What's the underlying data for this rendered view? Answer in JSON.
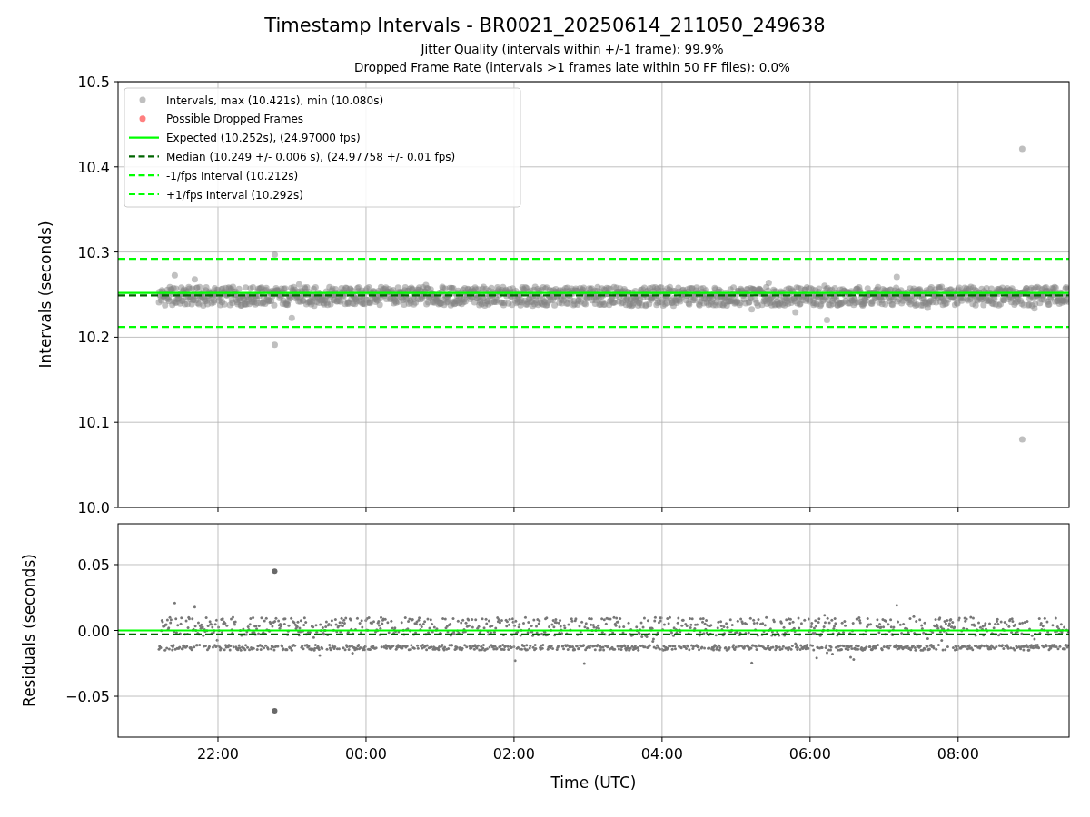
{
  "figure": {
    "title": "Timestamp Intervals - BR0021_20250614_211050_249638",
    "subtitles": [
      "Jitter Quality (intervals within +/-1 frame): 99.9%",
      "Dropped Frame Rate (intervals >1 frames late within 50 FF files): 0.0%"
    ]
  },
  "intervals_plot": {
    "chart_data": {
      "type": "scatter",
      "ylabel": "Intervals (seconds)",
      "grid": true,
      "legend": "upper left",
      "xlim": [
        "2025-06-14T20:39",
        "2025-06-15T09:30"
      ],
      "ylim": [
        10.0,
        10.5
      ],
      "yticks": [
        {
          "value": 10.0,
          "label": "10.0"
        },
        {
          "value": 10.1,
          "label": "10.1"
        },
        {
          "value": 10.2,
          "label": "10.2"
        },
        {
          "value": 10.3,
          "label": "10.3"
        },
        {
          "value": 10.4,
          "label": "10.4"
        },
        {
          "value": 10.5,
          "label": "10.5"
        }
      ],
      "series": [
        {
          "name": "Intervals, max (10.421s), min (10.080s)",
          "color": "#808080",
          "x": [
            "2025-06-14T22:46",
            "2025-06-14T22:46",
            "2025-06-15T08:52",
            "2025-06-15T08:52"
          ],
          "values": [
            10.297,
            10.191,
            10.421,
            10.08
          ]
        },
        {
          "name": "Possible Dropped Frames",
          "color": "#ff0000"
        },
        {
          "name": "Expected (10.252s), (24.97000 fps)",
          "type": "line",
          "line_style": "solid",
          "color": "#00ff00",
          "x": [
            "2025-06-14T20:39",
            "2025-06-15T09:30"
          ],
          "values": [
            10.252,
            10.252
          ]
        },
        {
          "name": "Median (10.249 +/- 0.006 s), (24.97758 +/- 0.01 fps)",
          "type": "line",
          "line_style": "dashed",
          "color": "#006400",
          "x": [
            "2025-06-14T20:39",
            "2025-06-15T09:30"
          ],
          "values": [
            10.249,
            10.249
          ]
        },
        {
          "name": "-1/fps Interval (10.212s)",
          "type": "line",
          "line_style": "dashed",
          "color": "#00ff00",
          "x": [
            "2025-06-14T20:39",
            "2025-06-15T09:30"
          ],
          "values": [
            10.212,
            10.212
          ]
        },
        {
          "name": "+1/fps Interval (10.292s)",
          "type": "line",
          "line_style": "dashed",
          "color": "#00ff00",
          "x": [
            "2025-06-14T20:39",
            "2025-06-15T09:30"
          ],
          "values": [
            10.292,
            10.292
          ]
        }
      ]
    }
  },
  "residuals_plot": {
    "chart_data": {
      "type": "scatter",
      "xlabel": "Time (UTC)",
      "ylabel": "Residuals (seconds)",
      "grid": true,
      "xlim": [
        "2025-06-14T20:39",
        "2025-06-15T09:30"
      ],
      "ylim": [
        -0.081,
        0.081
      ],
      "xticks": [
        {
          "value": "2025-06-14T22:00",
          "label": "22:00"
        },
        {
          "value": "2025-06-15T00:00",
          "label": "00:00"
        },
        {
          "value": "2025-06-15T02:00",
          "label": "02:00"
        },
        {
          "value": "2025-06-15T04:00",
          "label": "04:00"
        },
        {
          "value": "2025-06-15T06:00",
          "label": "06:00"
        },
        {
          "value": "2025-06-15T08:00",
          "label": "08:00"
        }
      ],
      "yticks": [
        {
          "value": -0.05,
          "label": "−0.05"
        },
        {
          "value": 0,
          "label": "0.00"
        },
        {
          "value": 0.05,
          "label": "0.05"
        }
      ],
      "series": [
        {
          "color": "#696969",
          "x": [
            "2025-06-14T22:46",
            "2025-06-14T22:46"
          ],
          "values": [
            0.045,
            -0.061
          ]
        },
        {
          "type": "line",
          "line_style": "solid",
          "color": "#00ff00",
          "x": [
            "2025-06-14T20:39",
            "2025-06-15T09:30"
          ],
          "values": [
            0.0,
            0.0
          ]
        },
        {
          "type": "line",
          "line_style": "dashed",
          "color": "#006400",
          "x": [
            "2025-06-14T20:39",
            "2025-06-15T09:30"
          ],
          "values": [
            -0.003,
            -0.003
          ]
        }
      ]
    }
  }
}
